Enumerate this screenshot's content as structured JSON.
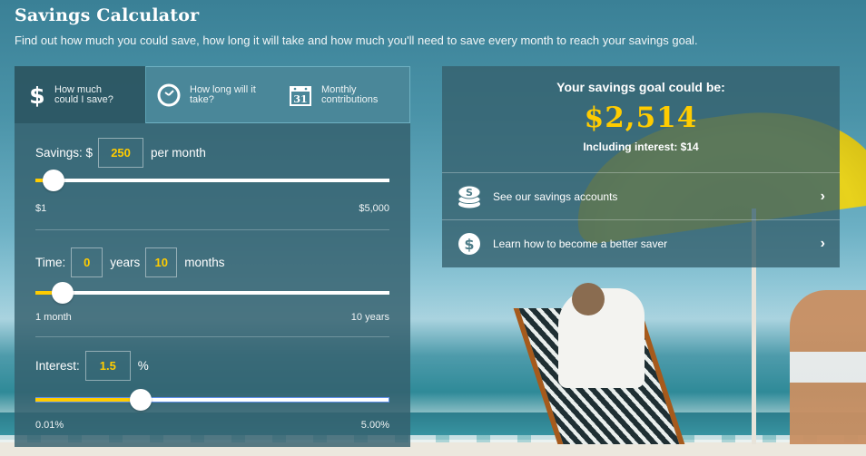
{
  "header": {
    "title": "Savings Calculator",
    "subtitle": "Find out how much you could save, how long it will take and how much you'll need to save every month to reach your savings goal."
  },
  "tabs": [
    {
      "label": "How much\ncould I save?",
      "icon": "dollar-icon",
      "active": true
    },
    {
      "label": "How long will it\ntake?",
      "icon": "clock-icon",
      "active": false
    },
    {
      "label": "Monthly\ncontributions",
      "icon": "calendar-icon",
      "active": false,
      "icon_text": "31"
    }
  ],
  "savings": {
    "label": "Savings: $",
    "value": "250",
    "suffix": "per month",
    "min_label": "$1",
    "max_label": "$5,000",
    "slider_fraction": 0.05
  },
  "time": {
    "label": "Time:",
    "years_value": "0",
    "years_label": "years",
    "months_value": "10",
    "months_label": "months",
    "min_label": "1 month",
    "max_label": "10 years",
    "slider_fraction": 0.077
  },
  "interest": {
    "label": "Interest:",
    "value": "1.5",
    "suffix": "%",
    "min_label": "0.01%",
    "max_label": "5.00%",
    "slider_fraction": 0.298
  },
  "result": {
    "lead": "Your savings goal could be:",
    "amount": "$2,514",
    "interest_note": "Including interest: $14",
    "links": [
      {
        "label": "See our savings accounts",
        "icon": "coins-stack-icon"
      },
      {
        "label": "Learn how to become a better saver",
        "icon": "dollar-circle-icon"
      }
    ]
  },
  "colors": {
    "accent": "#ffcc00",
    "panel": "#345f6c",
    "tab_inactive": "#4a8799"
  }
}
